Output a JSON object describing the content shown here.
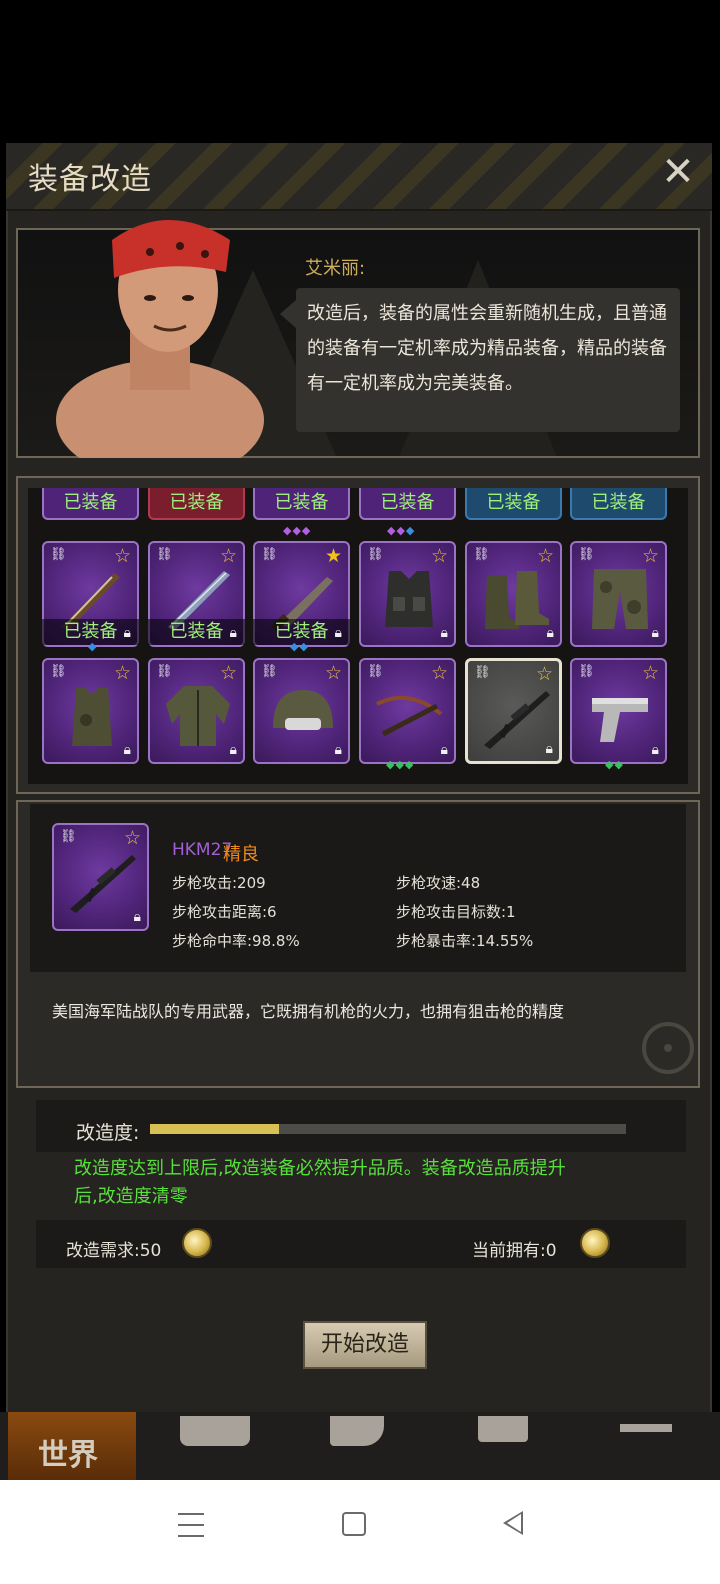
{
  "dialog": {
    "title": "装备改造",
    "close_icon": "close-icon"
  },
  "npc": {
    "name": "艾米丽:",
    "speech": "改造后，装备的属性会重新随机生成，且普通的装备有一定机率成为精品装备，精品的装备有一定机率成为完美装备。"
  },
  "grid": {
    "top_row": [
      "已装备",
      "已装备",
      "已装备",
      "已装备",
      "已装备",
      "已装备"
    ],
    "row2": [
      {
        "item": "machete",
        "equipped": "已装备"
      },
      {
        "item": "saw-blade",
        "equipped": "已装备"
      },
      {
        "item": "knife",
        "equipped": "已装备"
      },
      {
        "item": "tactical-vest",
        "equipped": ""
      },
      {
        "item": "camo-boots",
        "equipped": ""
      },
      {
        "item": "camo-pants",
        "equipped": ""
      }
    ],
    "row3": [
      {
        "item": "camo-tank-top"
      },
      {
        "item": "camo-jacket"
      },
      {
        "item": "helmet"
      },
      {
        "item": "crossbow"
      },
      {
        "item": "assault-rifle"
      },
      {
        "item": "pistol"
      }
    ]
  },
  "detail": {
    "name": "HKM27",
    "quality": "精良",
    "stats": {
      "attack": "步枪攻击:209",
      "speed": "步枪攻速:48",
      "range": "步枪攻击距离:6",
      "targets": "步枪攻击目标数:1",
      "accuracy": "步枪命中率:98.8%",
      "crit": "步枪暴击率:14.55%"
    },
    "description": "美国海军陆战队的专用武器，它既拥有机枪的火力，也拥有狙击枪的精度"
  },
  "progress": {
    "label": "改造度:",
    "fraction": 0.27,
    "hint": "改造度达到上限后,改造装备必然提升品质。装备改造品质提升后,改造度清零"
  },
  "cost": {
    "required": "改造需求:50",
    "owned": "当前拥有:0"
  },
  "start_button": "开始改造",
  "tabs": {
    "world": "世界"
  },
  "colors": {
    "slot_purple": "#4f2478",
    "equipped_green": "#9ef07a",
    "hint_green": "#58e03c",
    "quality_orange": "#f08a1c",
    "progress_gold": "#d8c054"
  }
}
